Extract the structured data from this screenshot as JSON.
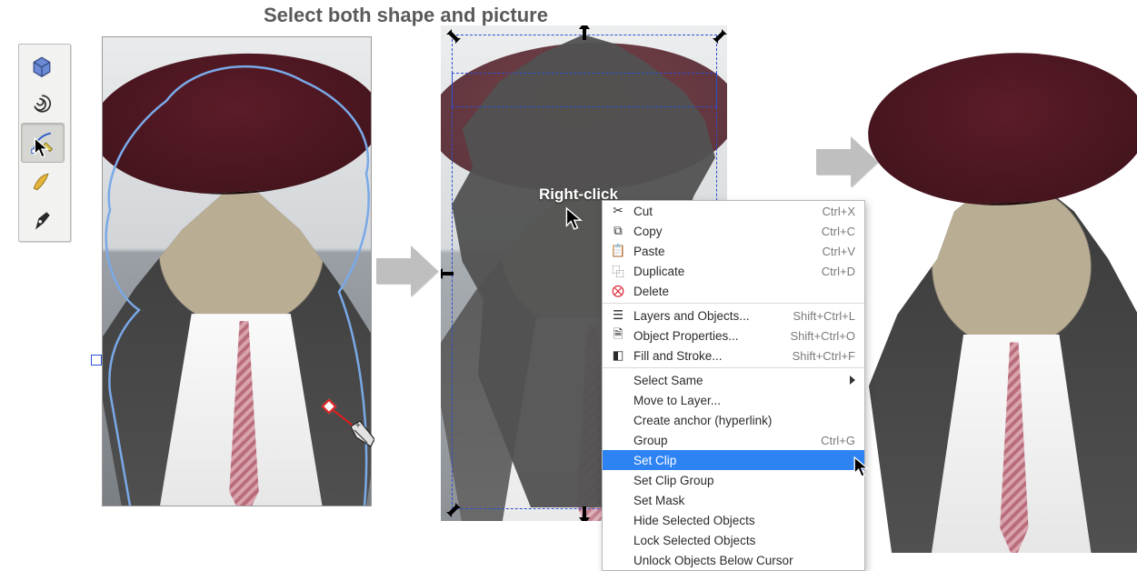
{
  "title": "Select both shape and picture",
  "right_click_label": "Right-click",
  "toolbox": {
    "tools": [
      {
        "name": "3d-box-tool"
      },
      {
        "name": "spiral-tool"
      },
      {
        "name": "bezier-pen-tool",
        "selected": true
      },
      {
        "name": "calligraphy-tool"
      },
      {
        "name": "pen-tool"
      }
    ]
  },
  "context_menu": {
    "items": [
      {
        "icon": "cut-icon",
        "label": "Cut",
        "shortcut": "Ctrl+X"
      },
      {
        "icon": "copy-icon",
        "label": "Copy",
        "shortcut": "Ctrl+C"
      },
      {
        "icon": "paste-icon",
        "label": "Paste",
        "shortcut": "Ctrl+V"
      },
      {
        "icon": "duplicate-icon",
        "label": "Duplicate",
        "shortcut": "Ctrl+D"
      },
      {
        "icon": "delete-icon",
        "label": "Delete",
        "shortcut": ""
      },
      {
        "separator": true
      },
      {
        "icon": "layers-icon",
        "label": "Layers and Objects...",
        "shortcut": "Shift+Ctrl+L"
      },
      {
        "icon": "properties-icon",
        "label": "Object Properties...",
        "shortcut": "Shift+Ctrl+O"
      },
      {
        "icon": "fill-icon",
        "label": "Fill and Stroke...",
        "shortcut": "Shift+Ctrl+F"
      },
      {
        "separator": true
      },
      {
        "indent": true,
        "label": "Select Same",
        "submenu": true
      },
      {
        "indent": true,
        "label": "Move to Layer..."
      },
      {
        "indent": true,
        "label": "Create anchor (hyperlink)"
      },
      {
        "indent": true,
        "label": "Group",
        "shortcut": "Ctrl+G"
      },
      {
        "indent": true,
        "label": "Set Clip",
        "highlight": true
      },
      {
        "indent": true,
        "label": "Set Clip Group"
      },
      {
        "indent": true,
        "label": "Set Mask"
      },
      {
        "indent": true,
        "label": "Hide Selected Objects"
      },
      {
        "indent": true,
        "label": "Lock Selected Objects"
      },
      {
        "indent": true,
        "label": "Unlock Objects Below Cursor"
      }
    ]
  }
}
